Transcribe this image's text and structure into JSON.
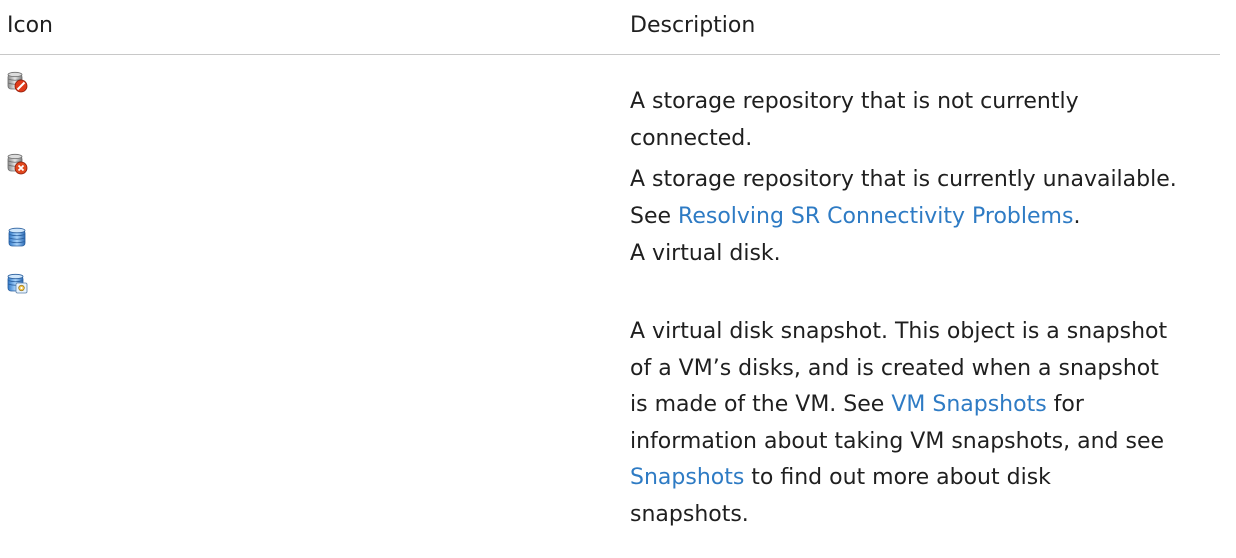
{
  "table": {
    "headers": {
      "icon": "Icon",
      "description": "Description"
    },
    "rows": [
      {
        "icon": "storage-repository-disconnected-icon",
        "lines": [
          "A storage repository that is not currently",
          "connected."
        ]
      },
      {
        "icon": "storage-repository-unavailable-icon",
        "line1": "A storage repository that is currently unavailable.",
        "line2_prefix": "See ",
        "link": "Resolving SR Connectivity Problems",
        "line2_suffix": "."
      },
      {
        "icon": "virtual-disk-icon",
        "lines": [
          "A virtual disk."
        ]
      },
      {
        "icon": "virtual-disk-snapshot-icon",
        "line1": "A virtual disk snapshot. This object is a snapshot",
        "line2": "of a VM’s disks, and is created when a snapshot",
        "line3_prefix": "is made of the VM. See ",
        "link_vm_snapshots": "VM Snapshots",
        "line3_suffix": " for",
        "line4": "information about taking VM snapshots, and see",
        "link_snapshots": "Snapshots",
        "line5_suffix": " to find out more about disk",
        "line6": "snapshots."
      }
    ]
  },
  "colors": {
    "link": "#2e7bc4",
    "text": "#1f1f1f",
    "divider": "#c8c8c8"
  }
}
